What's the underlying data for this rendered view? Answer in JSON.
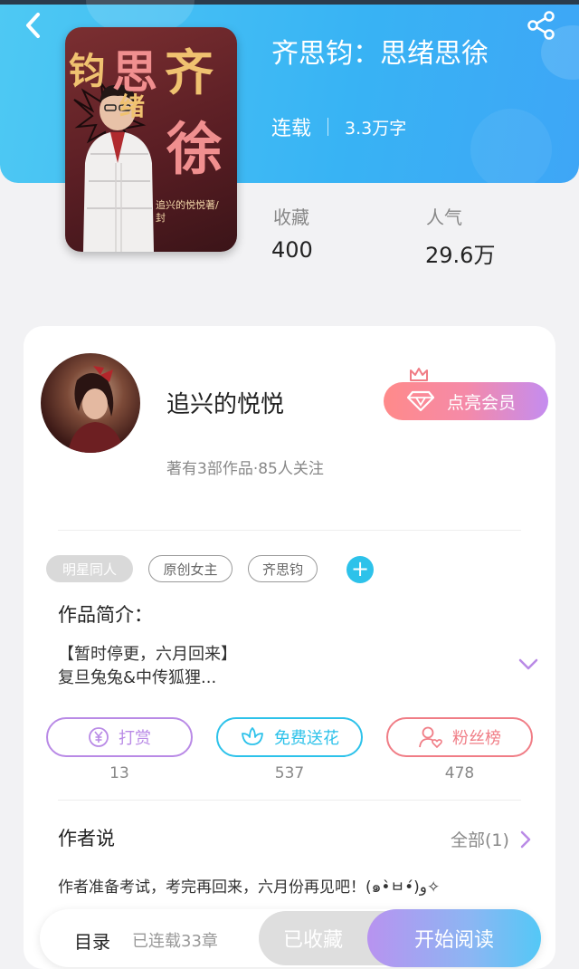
{
  "header": {
    "title": "齐思钧：思绪思徐",
    "status": "连载",
    "word_count": "3.3万字",
    "accent_color": "#38b3f4"
  },
  "cover": {
    "title_chars": [
      "齐",
      "思",
      "钧",
      "绪",
      "徐"
    ],
    "author_line": "追兴的悦悦著/封"
  },
  "stats": [
    {
      "label": "收藏",
      "value": "400"
    },
    {
      "label": "人气",
      "value": "29.6万"
    }
  ],
  "author": {
    "name": "追兴的悦悦",
    "info": "著有3部作品·85人关注",
    "vip_button": "点亮会员"
  },
  "tags": [
    "明星同人",
    "原创女主",
    "齐思钧"
  ],
  "intro": {
    "heading": "作品简介：",
    "line1": "【暂时停更，六月回来】",
    "line2": "复旦兔兔&中传狐狸..."
  },
  "actions": [
    {
      "label": "打赏",
      "count": "13",
      "color": "#b98ae6",
      "icon": "yen-coin-icon"
    },
    {
      "label": "免费送花",
      "count": "537",
      "color": "#2dc2ea",
      "icon": "flower-icon"
    },
    {
      "label": "粉丝榜",
      "count": "478",
      "color": "#f07d86",
      "icon": "fan-user-icon"
    }
  ],
  "author_says": {
    "heading": "作者说",
    "see_all": "全部(1)",
    "note": "作者准备考试，考完再回来，六月份再见吧！(๑•̀ㅂ•́)و✧"
  },
  "bottom": {
    "toc": "目录",
    "chapters": "已连载33章",
    "collected": "已收藏",
    "start_reading": "开始阅读"
  }
}
